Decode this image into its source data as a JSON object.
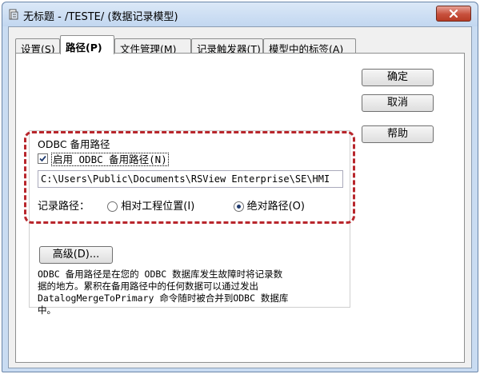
{
  "window": {
    "title": "无标题 - /TESTE/ (数据记录模型)"
  },
  "tabs": [
    {
      "label": "设置(S)",
      "active": false
    },
    {
      "label": "路径(P)",
      "active": true
    },
    {
      "label": "文件管理(M)",
      "active": false
    },
    {
      "label": "记录触发器(T)",
      "active": false
    },
    {
      "label": "模型中的标签(A)",
      "active": false
    }
  ],
  "buttons": {
    "ok": "确定",
    "cancel": "取消",
    "help": "帮助"
  },
  "odbc": {
    "group_title": "ODBC 备用路径",
    "enable_label": "启用 ODBC 备用路径(N)",
    "enable_checked": true,
    "path_value": "C:\\Users\\Public\\Documents\\RSView Enterprise\\SE\\HMI",
    "log_path_label": "记录路径：",
    "radio_relative": "相对工程位置(I)",
    "radio_absolute": "绝对路径(O)",
    "selected": "absolute",
    "advanced_button": "高级(D)...",
    "description": "ODBC 备用路径是在您的 ODBC 数据库发生故障时将记录数\n据的地方。累积在备用路径中的任何数据可以通过发出\nDatalogMergeToPrimary 命令随时被合并到ODBC 数据库\n中。"
  },
  "colors": {
    "highlight": "#b8262c",
    "close_button": "#c7503c"
  }
}
